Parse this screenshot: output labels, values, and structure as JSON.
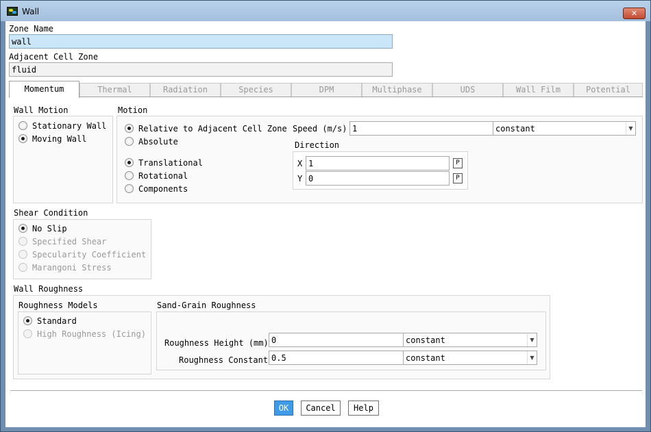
{
  "window": {
    "title": "Wall",
    "close_label": "✕"
  },
  "zone": {
    "name_label": "Zone Name",
    "name_value": "wall",
    "adjacent_label": "Adjacent Cell Zone",
    "adjacent_value": "fluid"
  },
  "tabs": [
    "Momentum",
    "Thermal",
    "Radiation",
    "Species",
    "DPM",
    "Multiphase",
    "UDS",
    "Wall Film",
    "Potential"
  ],
  "wall_motion": {
    "title": "Wall Motion",
    "options": [
      "Stationary Wall",
      "Moving Wall"
    ],
    "selected": "Moving Wall"
  },
  "motion": {
    "title": "Motion",
    "reference": [
      "Relative to Adjacent Cell Zone",
      "Absolute"
    ],
    "reference_selected": "Relative to Adjacent Cell Zone",
    "type": [
      "Translational",
      "Rotational",
      "Components"
    ],
    "type_selected": "Translational",
    "speed_label": "Speed (m/s)",
    "speed_value": "1",
    "speed_mode": "constant",
    "direction_label": "Direction",
    "x_label": "X",
    "x_value": "1",
    "y_label": "Y",
    "y_value": "0",
    "p_label": "P"
  },
  "shear": {
    "title": "Shear Condition",
    "options": [
      "No Slip",
      "Specified Shear",
      "Specularity Coefficient",
      "Marangoni Stress"
    ],
    "selected": "No Slip"
  },
  "roughness": {
    "title": "Wall Roughness",
    "models_title": "Roughness Models",
    "models": [
      "Standard",
      "High Roughness (Icing)"
    ],
    "model_selected": "Standard",
    "sand_title": "Sand-Grain Roughness",
    "height_label": "Roughness Height (mm)",
    "height_value": "0",
    "height_mode": "constant",
    "constant_label": "Roughness Constant",
    "constant_value": "0.5",
    "constant_mode": "constant"
  },
  "buttons": {
    "ok": "OK",
    "cancel": "Cancel",
    "help": "Help"
  },
  "colors": {
    "selected_field": "#cce6f9",
    "ok_button": "#3f9be8",
    "title_bar": "#a3bfdd"
  },
  "icons": {
    "app": "fluent-app-icon",
    "close": "close-icon",
    "dropdown": "chevron-down-icon"
  }
}
